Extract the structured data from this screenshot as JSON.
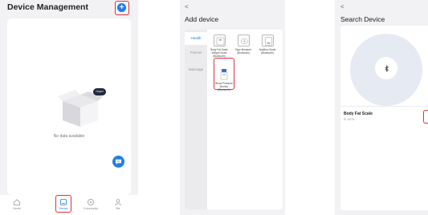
{
  "screen1": {
    "title": "Device Management",
    "add_button_label": "+",
    "empty_badge": "Oops!",
    "empty_text": "No data available",
    "tabs": [
      {
        "label": "Home",
        "icon": "home-icon"
      },
      {
        "label": "Device",
        "icon": "device-icon",
        "active": true
      },
      {
        "label": "Community",
        "icon": "community-icon"
      },
      {
        "label": "Me",
        "icon": "user-icon"
      }
    ],
    "accent": "#1f7ee6",
    "highlight": "#e0303a"
  },
  "screen2": {
    "back": "<",
    "title": "Add device",
    "categories": [
      "Health",
      "Fitness",
      "Massage"
    ],
    "devices": [
      {
        "name": "Body Fat Scale Weight Scale (Bluetooth)",
        "icon": "scale-icon"
      },
      {
        "name": "Tape Measure (Bluetooth)",
        "icon": "tape-measure-icon"
      },
      {
        "name": "Nutrition Scale (Bluetooth)",
        "icon": "nutrition-scale-icon"
      },
      {
        "name": "Blood Pressure Monitor (Bluetooth)",
        "icon": "blood-pressure-icon"
      }
    ]
  },
  "screen3": {
    "back": "<",
    "title": "Search Device",
    "found_device": {
      "name": "Body Fat Scale",
      "id": "IF-4078"
    }
  }
}
